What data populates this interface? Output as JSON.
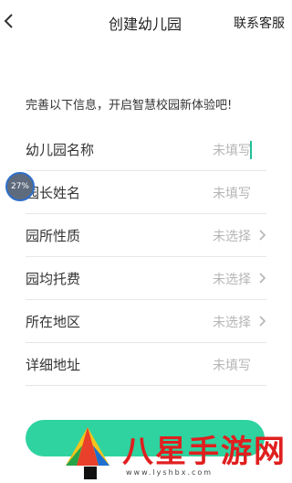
{
  "header": {
    "title": "创建幼儿园",
    "contact_label": "联系客服"
  },
  "intro": "完善以下信息，开启智慧校园新体验吧!",
  "form": {
    "rows": [
      {
        "label": "幼儿园名称",
        "value": "未填写"
      },
      {
        "label": "园长姓名",
        "value": "未填写"
      },
      {
        "label": "园所性质",
        "value": "未选择"
      },
      {
        "label": "园均托费",
        "value": "未选择"
      },
      {
        "label": "所在地区",
        "value": "未选择"
      },
      {
        "label": "详细地址",
        "value": "未填写"
      }
    ]
  },
  "overlay": {
    "progress": "27%"
  },
  "watermark": {
    "text": "八星手游网",
    "url": "www.lyshbx.com"
  },
  "colors": {
    "accent": "#2ed3a0",
    "caret": "#1fbf98",
    "watermark": "#e01f1f"
  }
}
